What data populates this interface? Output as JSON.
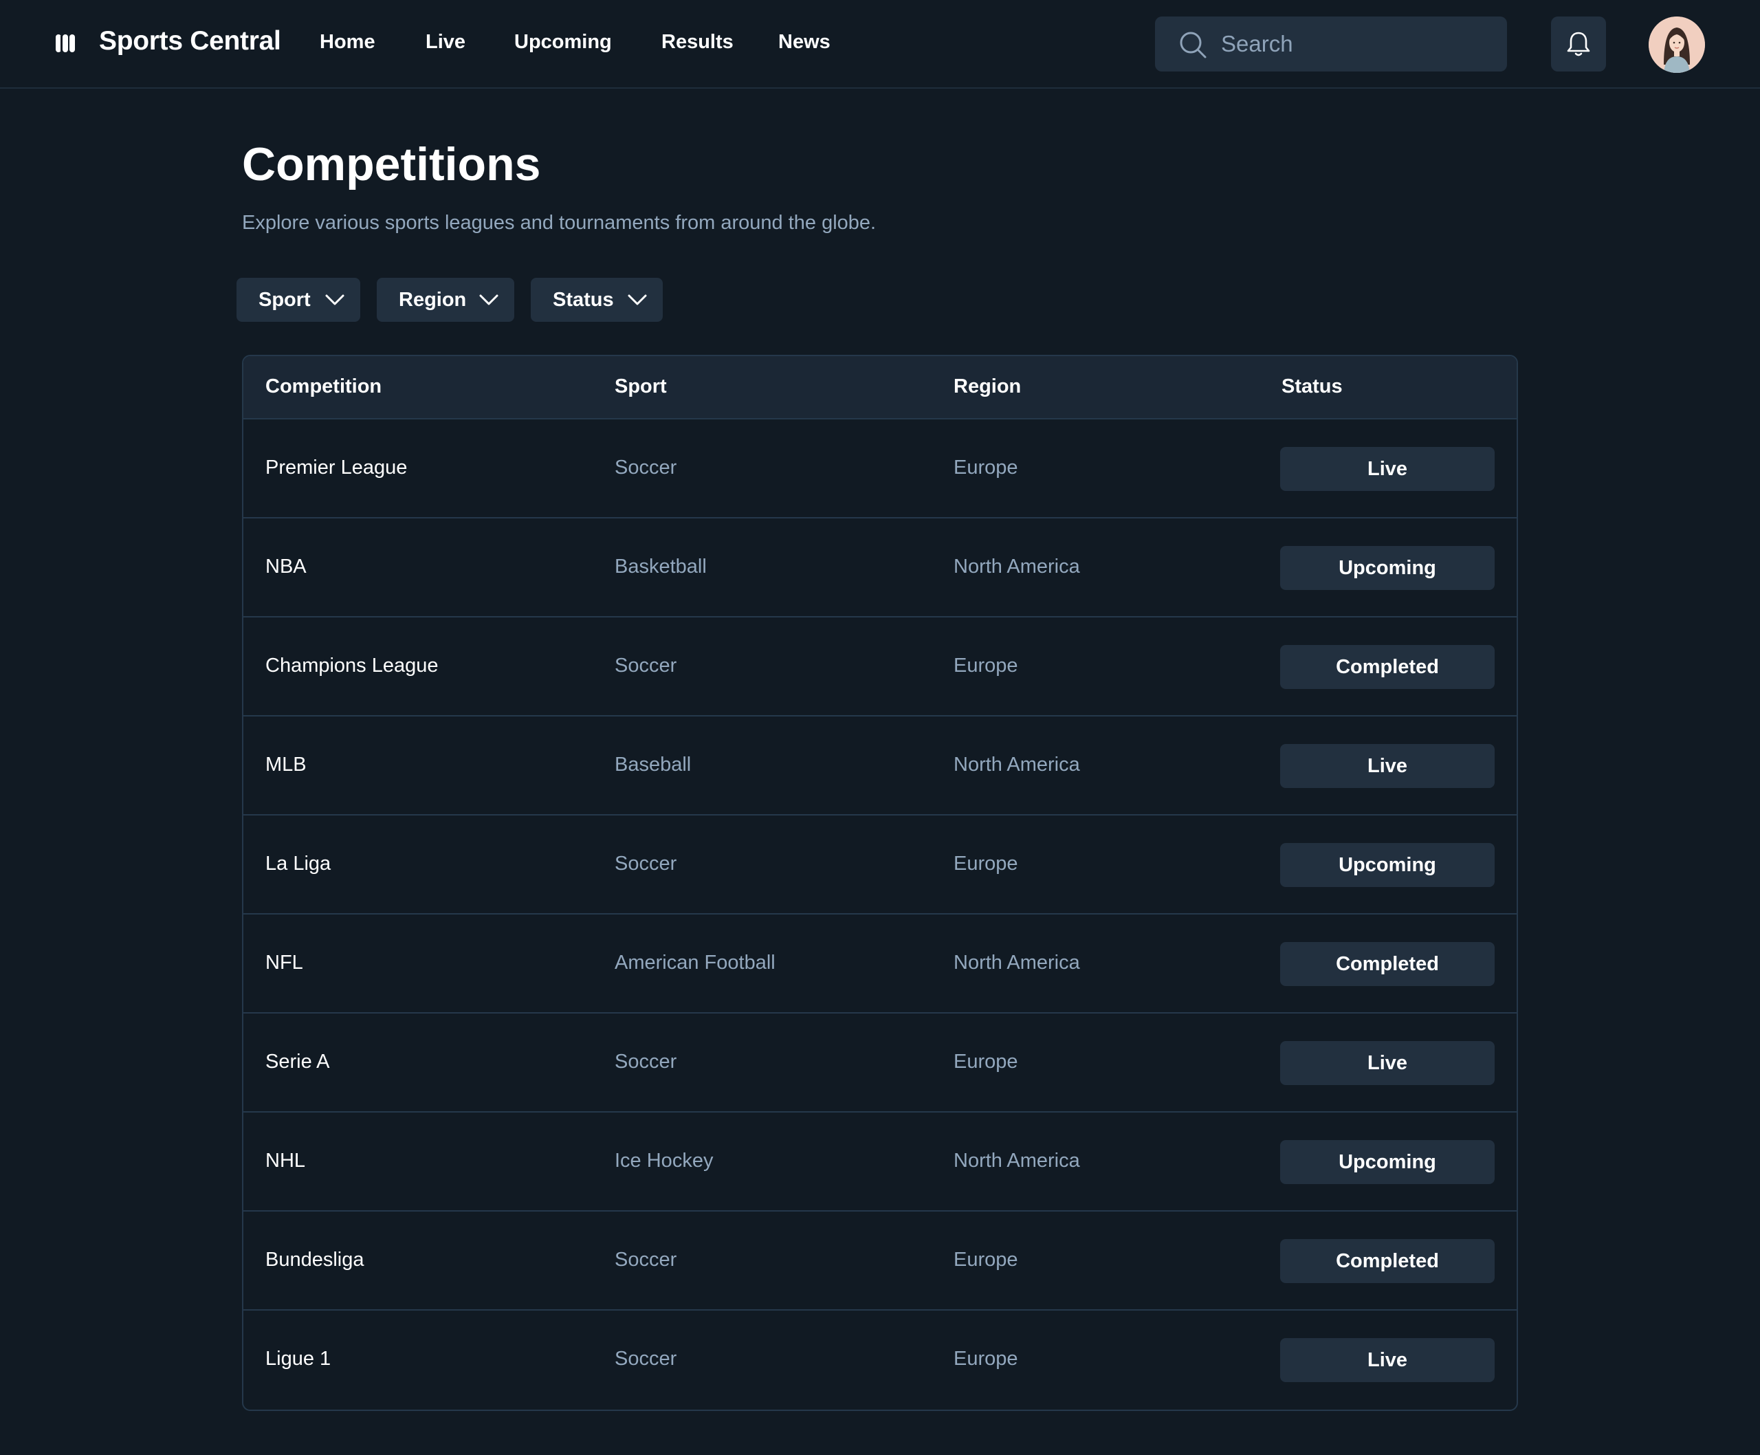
{
  "header": {
    "brand": "Sports Central",
    "nav": [
      "Home",
      "Live",
      "Upcoming",
      "Results",
      "News"
    ],
    "search_placeholder": "Search",
    "icons": {
      "logo": "logo-icon",
      "search": "search-icon",
      "bell": "bell-icon",
      "avatar": "avatar"
    }
  },
  "page": {
    "title": "Competitions",
    "subtitle": "Explore various sports leagues and tournaments from around the globe."
  },
  "filters": [
    "Sport",
    "Region",
    "Status"
  ],
  "table": {
    "columns": [
      "Competition",
      "Sport",
      "Region",
      "Status"
    ],
    "rows": [
      {
        "competition": "Premier League",
        "sport": "Soccer",
        "region": "Europe",
        "status": "Live"
      },
      {
        "competition": "NBA",
        "sport": "Basketball",
        "region": "North America",
        "status": "Upcoming"
      },
      {
        "competition": "Champions League",
        "sport": "Soccer",
        "region": "Europe",
        "status": "Completed"
      },
      {
        "competition": "MLB",
        "sport": "Baseball",
        "region": "North America",
        "status": "Live"
      },
      {
        "competition": "La Liga",
        "sport": "Soccer",
        "region": "Europe",
        "status": "Upcoming"
      },
      {
        "competition": "NFL",
        "sport": "American Football",
        "region": "North America",
        "status": "Completed"
      },
      {
        "competition": "Serie A",
        "sport": "Soccer",
        "region": "Europe",
        "status": "Live"
      },
      {
        "competition": "NHL",
        "sport": "Ice Hockey",
        "region": "North America",
        "status": "Upcoming"
      },
      {
        "competition": "Bundesliga",
        "sport": "Soccer",
        "region": "Europe",
        "status": "Completed"
      },
      {
        "competition": "Ligue 1",
        "sport": "Soccer",
        "region": "Europe",
        "status": "Live"
      }
    ]
  },
  "colors": {
    "background": "#111a23",
    "surface": "#22303f",
    "table_header": "#1b2735",
    "border": "#25384b",
    "muted_text": "#93a8be"
  }
}
